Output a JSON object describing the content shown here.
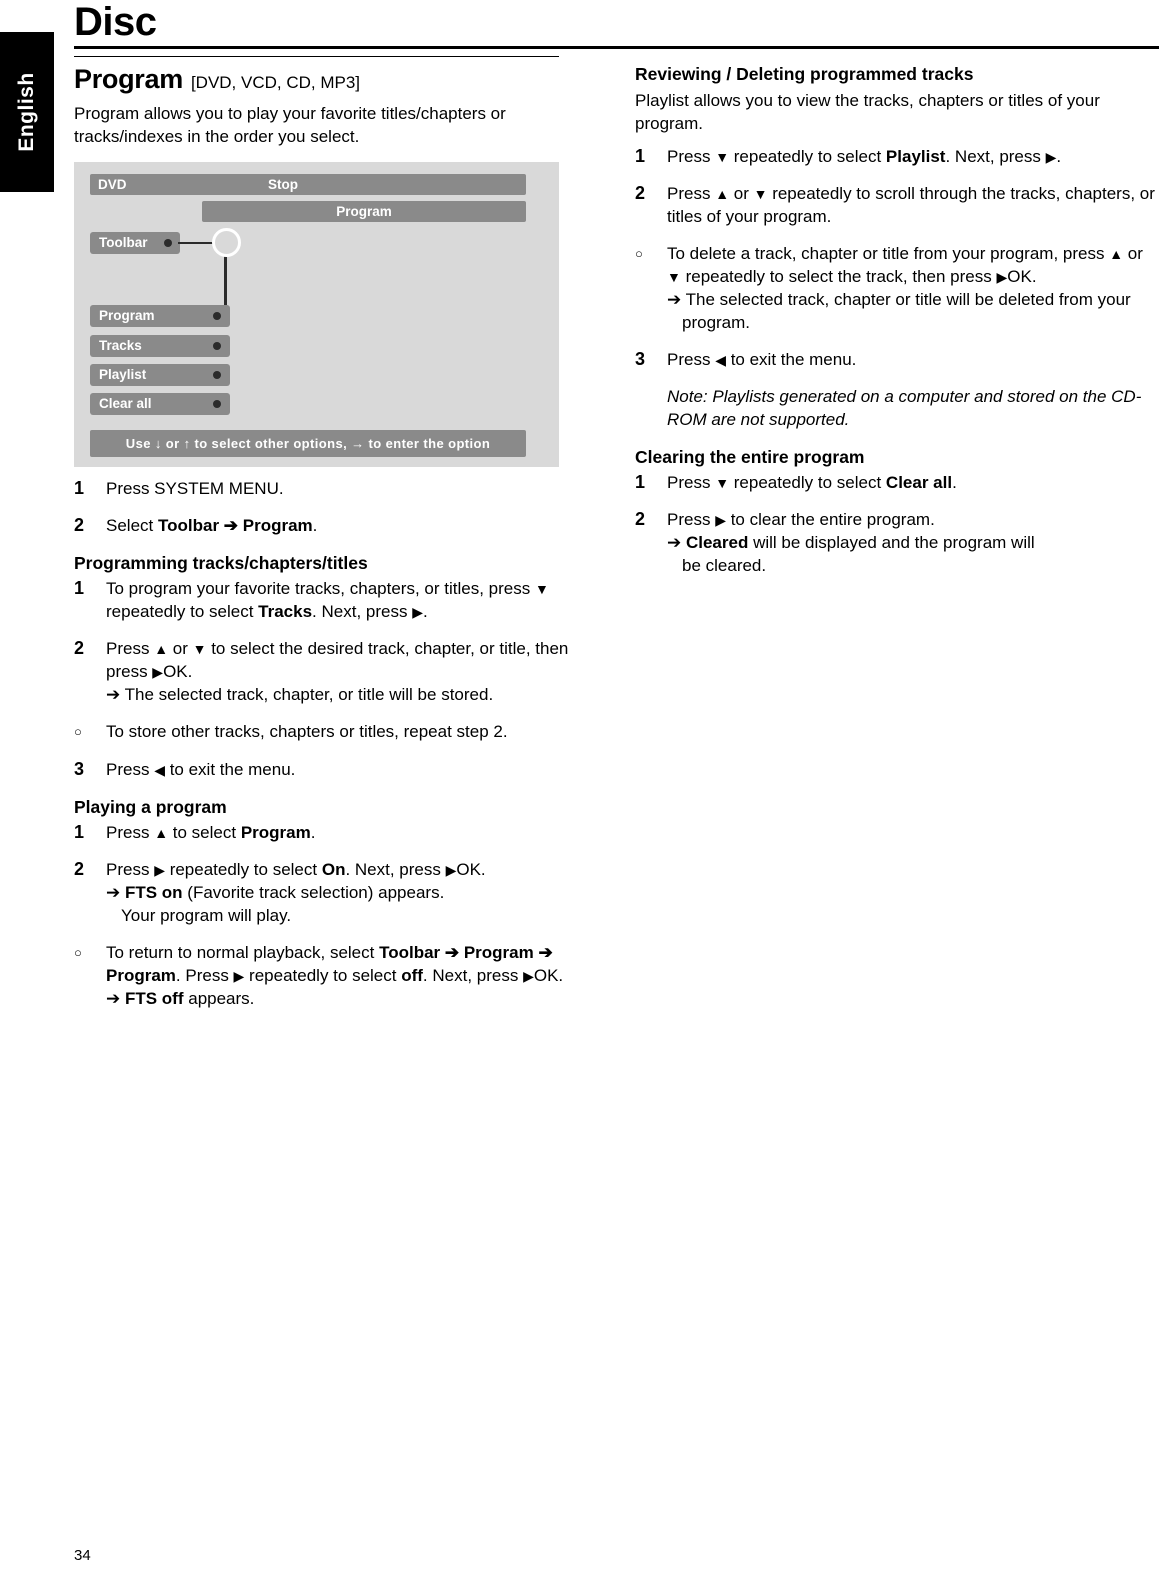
{
  "language_tab": "English",
  "header": {
    "title": "Disc"
  },
  "page_number": "34",
  "left": {
    "section_title": "Program",
    "section_title_bracket": "[DVD, VCD, CD, MP3]",
    "intro": "Program allows you to play your favorite titles/chapters or tracks/indexes in the order you select.",
    "osd": {
      "source_label": "DVD",
      "status_label": "Stop",
      "program_bar_label": "Program",
      "toolbar_label": "Toolbar",
      "items": [
        {
          "label": "Program"
        },
        {
          "label": "Tracks"
        },
        {
          "label": "Playlist"
        },
        {
          "label": "Clear all"
        }
      ],
      "hint": "Use ↓ or ↑ to select other options, → to enter the option"
    },
    "steps_main": [
      {
        "num": "1",
        "text": "Press SYSTEM MENU."
      },
      {
        "num": "2",
        "text_html": "Select <b>Toolbar ➔ Program</b>."
      }
    ],
    "sub1_title": "Programming tracks/chapters/titles",
    "sub1_steps": [
      {
        "num": "1",
        "text_html": "To program your favorite tracks, chapters, or titles, press <span class=\"tri\">▼</span> repeatedly to select <b>Tracks</b>. Next, press <span class=\"tri\">▶</span>."
      },
      {
        "num": "2",
        "text_html": "Press <span class=\"tri\">▲</span> or <span class=\"tri\">▼</span> to select the desired track, chapter, or title, then press <span class=\"tri\">▶</span>OK.<span class=\"arrow-line\">➔ The selected track, chapter, or title will be stored.</span>"
      },
      {
        "num": "○",
        "bullet": true,
        "text_html": "To store other tracks, chapters or titles, repeat step 2."
      },
      {
        "num": "3",
        "text_html": "Press <span class=\"tri\">◀</span> to exit the menu."
      }
    ],
    "sub2_title": "Playing a program",
    "sub2_steps": [
      {
        "num": "1",
        "text_html": "Press <span class=\"tri\">▲</span> to select <b>Program</b>."
      },
      {
        "num": "2",
        "text_html": "Press <span class=\"tri\">▶</span> repeatedly to select <b>On</b>. Next, press <span class=\"tri\">▶</span>OK.<span class=\"arrow-line\">➔ <b>FTS on</b> (Favorite track selection) appears.</span><span class=\"indent\">Your program will play.</span>"
      },
      {
        "num": "○",
        "bullet": true,
        "text_html": "To return to normal playback, select <b>Toolbar ➔ Program ➔ Program</b>. Press <span class=\"tri\">▶</span> repeatedly to select <b>off</b>. Next, press <span class=\"tri\">▶</span>OK.<span class=\"arrow-line\">➔ <b>FTS off</b> appears.</span>"
      }
    ]
  },
  "right": {
    "sub1_title": "Reviewing / Deleting programmed tracks",
    "intro": "Playlist allows you to view the tracks, chapters or titles of your program.",
    "steps1": [
      {
        "num": "1",
        "text_html": "Press <span class=\"tri\">▼</span> repeatedly to select <b>Playlist</b>. Next, press <span class=\"tri\">▶</span>."
      },
      {
        "num": "2",
        "text_html": "Press <span class=\"tri\">▲</span> or <span class=\"tri\">▼</span> repeatedly to scroll through the tracks, chapters, or titles of your program."
      },
      {
        "num": "○",
        "bullet": true,
        "text_html": "To delete a track, chapter or title from your program, press <span class=\"tri\">▲</span> or <span class=\"tri\">▼</span> repeatedly to select the track, then press <span class=\"tri\">▶</span>OK.<span class=\"arrow-line\">➔ The selected track, chapter or title will be deleted from your program.</span>"
      },
      {
        "num": "3",
        "text_html": "Press <span class=\"tri\">◀</span> to exit the menu."
      }
    ],
    "note": "Note: Playlists generated on a computer and stored on the CD-ROM are not supported.",
    "sub2_title": "Clearing the entire program",
    "steps2": [
      {
        "num": "1",
        "text_html": "Press <span class=\"tri\">▼</span> repeatedly to select <b>Clear all</b>."
      },
      {
        "num": "2",
        "text_html": "Press <span class=\"tri\">▶</span> to clear the entire program.<span class=\"arrow-line\">➔ <b>Cleared</b> will be displayed and the program will</span><span class=\"indent\">be cleared.</span>"
      }
    ]
  }
}
